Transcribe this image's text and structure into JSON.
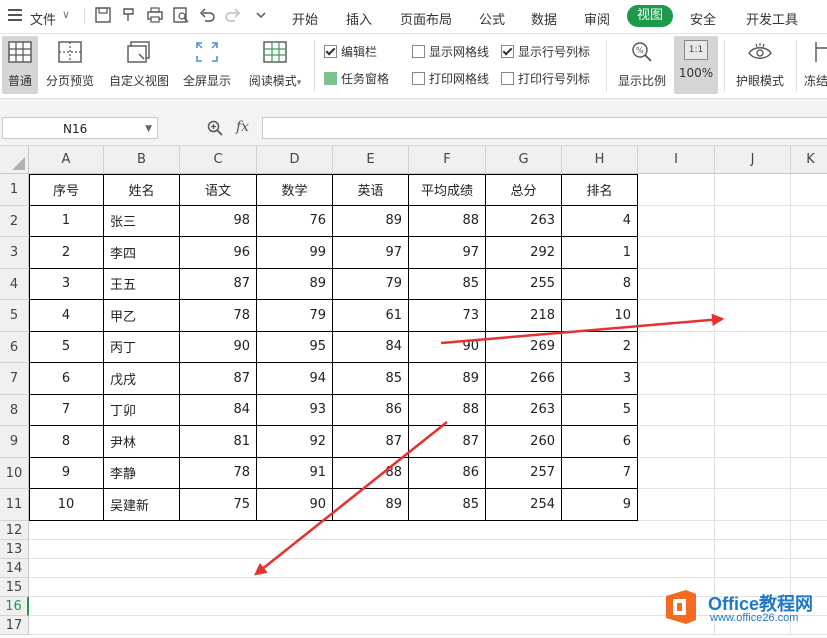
{
  "menubar": {
    "file_label": "文件",
    "items": [
      "开始",
      "插入",
      "页面布局",
      "公式",
      "数据",
      "审阅",
      "视图",
      "安全",
      "开发工具"
    ],
    "active": "视图"
  },
  "ribbon": {
    "normal": "普通",
    "page_break_preview": "分页预览",
    "custom_view": "自定义视图",
    "full_screen": "全屏显示",
    "reading_mode": "阅读模式",
    "edit_bar": "编辑栏",
    "task_pane": "任务窗格",
    "show_gridlines": "显示网格线",
    "print_gridlines": "打印网格线",
    "show_row_col_headers": "显示行号列标",
    "print_row_col_headers": "打印行号列标",
    "zoom_ratio": "显示比例",
    "zoom_100": "100%",
    "zoom_100_icon": "1:1",
    "eye_protection": "护眼模式",
    "freeze": "冻结"
  },
  "formula_bar": {
    "name_box": "N16",
    "fx": "fx",
    "value": ""
  },
  "sheet": {
    "columns": [
      "A",
      "B",
      "C",
      "D",
      "E",
      "F",
      "G",
      "H",
      "I",
      "J",
      "K"
    ],
    "rows": [
      "1",
      "2",
      "3",
      "4",
      "5",
      "6",
      "7",
      "8",
      "9",
      "10",
      "11",
      "12",
      "13",
      "14",
      "15",
      "16",
      "17"
    ],
    "current_row": "16",
    "headers": [
      "序号",
      "姓名",
      "语文",
      "数学",
      "英语",
      "平均成绩",
      "总分",
      "排名"
    ],
    "data": [
      [
        "1",
        "张三",
        "98",
        "76",
        "89",
        "88",
        "263",
        "4"
      ],
      [
        "2",
        "李四",
        "96",
        "99",
        "97",
        "97",
        "292",
        "1"
      ],
      [
        "3",
        "王五",
        "87",
        "89",
        "79",
        "85",
        "255",
        "8"
      ],
      [
        "4",
        "甲乙",
        "78",
        "79",
        "61",
        "73",
        "218",
        "10"
      ],
      [
        "5",
        "丙丁",
        "90",
        "95",
        "84",
        "90",
        "269",
        "2"
      ],
      [
        "6",
        "戊戌",
        "87",
        "94",
        "85",
        "89",
        "266",
        "3"
      ],
      [
        "7",
        "丁卯",
        "84",
        "93",
        "86",
        "88",
        "263",
        "5"
      ],
      [
        "8",
        "尹林",
        "81",
        "92",
        "87",
        "87",
        "260",
        "6"
      ],
      [
        "9",
        "李静",
        "78",
        "91",
        "88",
        "86",
        "257",
        "7"
      ],
      [
        "10",
        "吴建新",
        "75",
        "90",
        "89",
        "85",
        "254",
        "9"
      ]
    ]
  },
  "watermark": {
    "line1": "Office教程网",
    "line2": "www.office26.com"
  },
  "colors": {
    "accent_green": "#1a9a4a",
    "arrow_red": "#e8312f",
    "watermark_orange": "#f26b21",
    "watermark_blue": "#1f77c8"
  }
}
